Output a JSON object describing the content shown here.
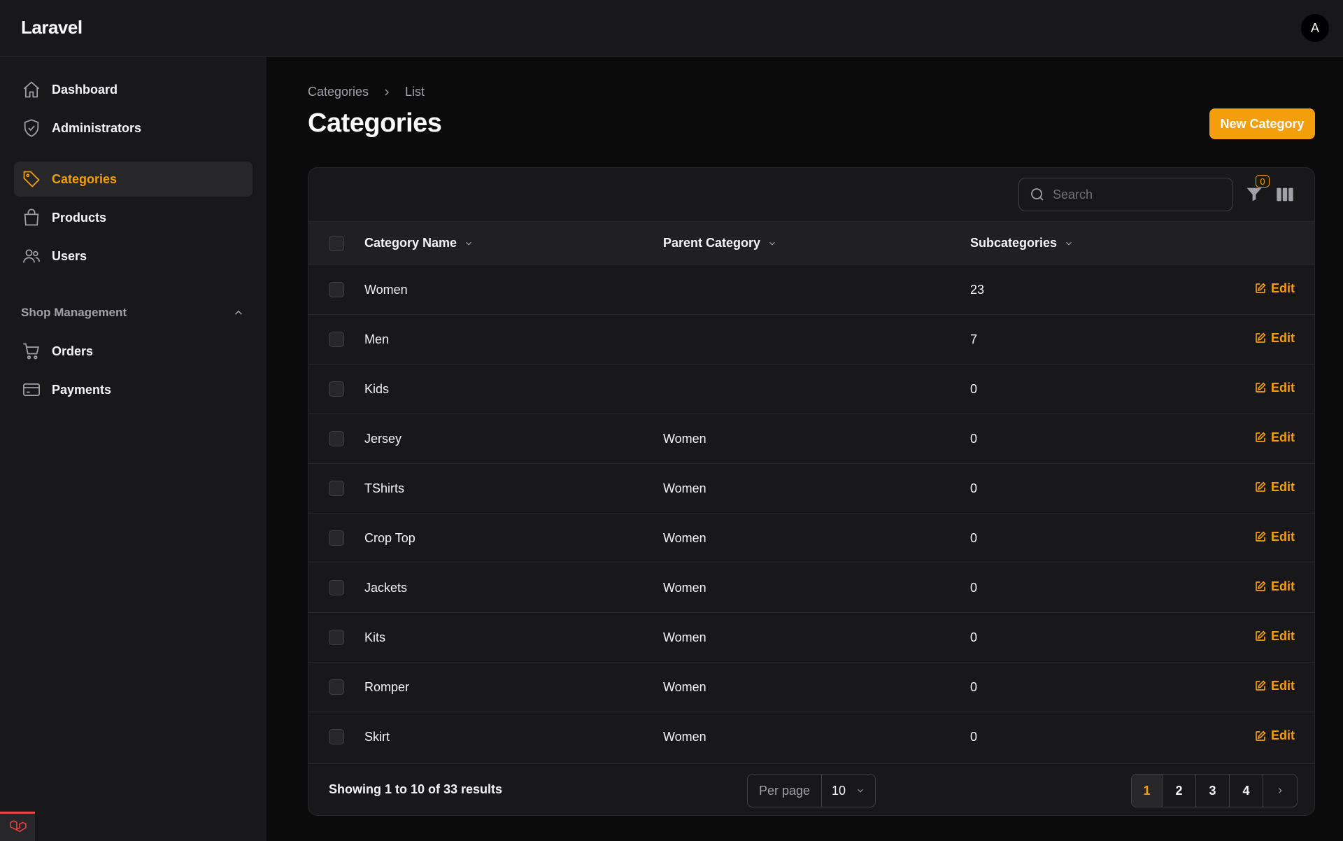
{
  "app": {
    "brand": "Laravel",
    "avatar_initial": "A"
  },
  "sidebar": {
    "items": [
      {
        "label": "Dashboard",
        "icon": "home-icon"
      },
      {
        "label": "Administrators",
        "icon": "shield-check-icon"
      },
      {
        "label": "Categories",
        "icon": "tag-icon",
        "active": true
      },
      {
        "label": "Products",
        "icon": "shopping-bag-icon"
      },
      {
        "label": "Users",
        "icon": "users-icon"
      }
    ],
    "group_label": "Shop Management",
    "group_items": [
      {
        "label": "Orders",
        "icon": "shopping-cart-icon"
      },
      {
        "label": "Payments",
        "icon": "credit-card-icon"
      }
    ]
  },
  "breadcrumb": {
    "parent": "Categories",
    "current": "List"
  },
  "page": {
    "title": "Categories",
    "new_button": "New Category"
  },
  "toolbar": {
    "search_placeholder": "Search",
    "filter_count": "0"
  },
  "table": {
    "columns": [
      "Category Name",
      "Parent Category",
      "Subcategories"
    ],
    "edit_label": "Edit",
    "rows": [
      {
        "name": "Women",
        "parent": "",
        "subcategories": "23"
      },
      {
        "name": "Men",
        "parent": "",
        "subcategories": "7"
      },
      {
        "name": "Kids",
        "parent": "",
        "subcategories": "0"
      },
      {
        "name": "Jersey",
        "parent": "Women",
        "subcategories": "0"
      },
      {
        "name": "TShirts",
        "parent": "Women",
        "subcategories": "0"
      },
      {
        "name": "Crop Top",
        "parent": "Women",
        "subcategories": "0"
      },
      {
        "name": "Jackets",
        "parent": "Women",
        "subcategories": "0"
      },
      {
        "name": "Kits",
        "parent": "Women",
        "subcategories": "0"
      },
      {
        "name": "Romper",
        "parent": "Women",
        "subcategories": "0"
      },
      {
        "name": "Skirt",
        "parent": "Women",
        "subcategories": "0"
      }
    ]
  },
  "footer": {
    "showing": "Showing 1 to 10 of 33 results",
    "per_page_label": "Per page",
    "per_page_value": "10",
    "pages": [
      "1",
      "2",
      "3",
      "4"
    ],
    "current_page": "1"
  },
  "colors": {
    "accent": "#f59e0b",
    "background": "#0b0b0c",
    "surface": "#18181b"
  }
}
